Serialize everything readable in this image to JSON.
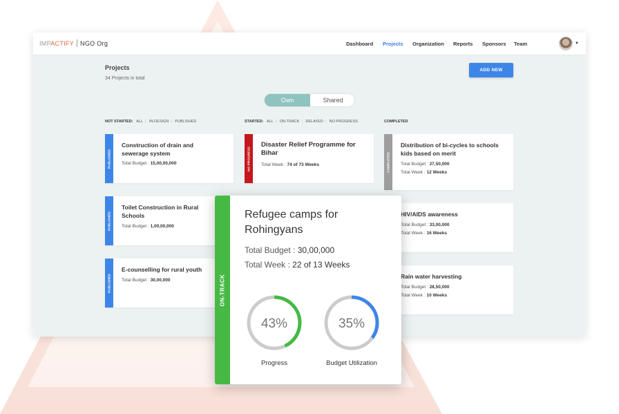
{
  "app": {
    "logo_a": "IMP",
    "logo_b": "ACTIFY",
    "org": "NGO Org"
  },
  "nav": {
    "items": [
      {
        "label": "Dashboard",
        "active": false
      },
      {
        "label": "Projects",
        "active": true
      },
      {
        "label": "Organization",
        "active": false
      },
      {
        "label": "Reports",
        "active": false
      },
      {
        "label": "Sponsors",
        "active": false
      },
      {
        "label": "Team",
        "active": false
      }
    ]
  },
  "page": {
    "title": "Projects",
    "subtitle": "34 Projects in total",
    "add_button": "ADD NEW"
  },
  "toggle": {
    "own": "Own",
    "shared": "Shared",
    "selected": "Own"
  },
  "columns": [
    {
      "heading": "NOT STARTED:",
      "filters": [
        "ALL",
        "IN-DESIGN",
        "PUBLISHED"
      ]
    },
    {
      "heading": "STARTED:",
      "filters": [
        "ALL",
        "ON-TRACK",
        "DELAYED",
        "NO-PROGRESS"
      ]
    },
    {
      "heading": "COMPLETED",
      "filters": []
    }
  ],
  "cards": {
    "c1": {
      "status": "PUBLISHED",
      "title": "Construction of drain and sewerage system",
      "meta_label": "Total Budget :",
      "meta_value": "15,00,00,000"
    },
    "c2": {
      "status": "PUBLISHED",
      "title": "Toilet Construction in Rural Schools",
      "meta_label": "Total Budget :",
      "meta_value": "1,00,00,000"
    },
    "c3": {
      "status": "PUBLISHED",
      "title": "E-counselling for rural youth",
      "meta_label": "Total Budget :",
      "meta_value": "30,00,000"
    },
    "s1": {
      "status": "NO PROGRESS",
      "title": "Disaster Relief Programme for Bihar",
      "meta_label": "Total Week :",
      "meta_value": "74 of 73 Weeks"
    },
    "d1": {
      "status": "COMPLETED",
      "title": "Distribution of bi-cycles to schools kids based on merit",
      "meta_label": "Total Budget :",
      "meta_value": "27,50,000",
      "meta2_label": "Total Week :",
      "meta2_value": "12 Weeks"
    },
    "d2": {
      "title": "HIV/AIDS awareness",
      "meta_label": "Total Budget :",
      "meta_value": "33,00,000",
      "meta2_label": "Total Week :",
      "meta2_value": "16 Weeks"
    },
    "d3": {
      "title": "Rain water harvesting",
      "meta_label": "Total Budget :",
      "meta_value": "28,50,000",
      "meta2_label": "Total Week :",
      "meta2_value": "10 Weeks"
    }
  },
  "popup": {
    "status": "ON-TRACK",
    "title": "Refugee camps for Rohingyans",
    "budget_label": "Total Budget :",
    "budget_value": "30,00,000",
    "week_label": "Total Week :",
    "week_value": "22 of 13 Weeks",
    "progress": {
      "value": 43,
      "text": "43%",
      "label": "Progress"
    },
    "budget_util": {
      "value": 35,
      "text": "35%",
      "label": "Budget Utilization"
    }
  },
  "colors": {
    "published": "#3d86e8",
    "no_progress": "#c5171d",
    "completed": "#9e9e9e",
    "on_track": "#46b945",
    "budget_ring": "#3d86e8",
    "ring_track": "#cccccc",
    "accent": "#3b7fdd",
    "deco": "#f7d9cf"
  }
}
